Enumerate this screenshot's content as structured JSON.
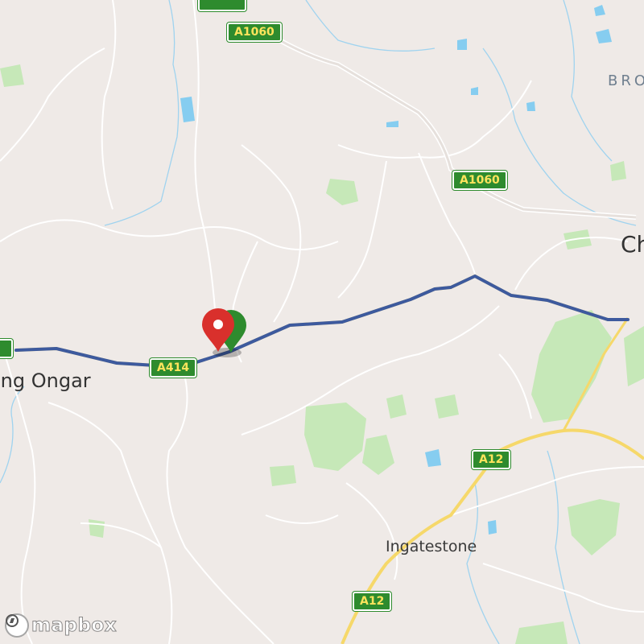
{
  "map": {
    "provider_logo": "mapbox",
    "places": {
      "ongar": "ing Ongar",
      "ingatestone": "Ingatestone",
      "chelmsford": "Ch",
      "broomfield": "BRO"
    },
    "roads": {
      "a1060_top": "A1060",
      "a1060_mid": "A1060",
      "a414": "A414",
      "a12_upper": "A12",
      "a12_lower": "A12"
    },
    "colors": {
      "background": "#efeae7",
      "route": "#3d5a9e",
      "major_road": "#f6d86a",
      "road_shield": "#2e8b2e",
      "shield_text": "#ffe45c",
      "water": "#7cc8ef",
      "park": "#bfe4b0",
      "start_marker": "#2e8b2e",
      "end_marker": "#d9302c"
    },
    "markers": [
      {
        "name": "start-marker",
        "icon": "map-pin-icon",
        "color": "#2e8b2e"
      },
      {
        "name": "destination-marker",
        "icon": "map-pin-icon",
        "color": "#d9302c"
      }
    ]
  }
}
